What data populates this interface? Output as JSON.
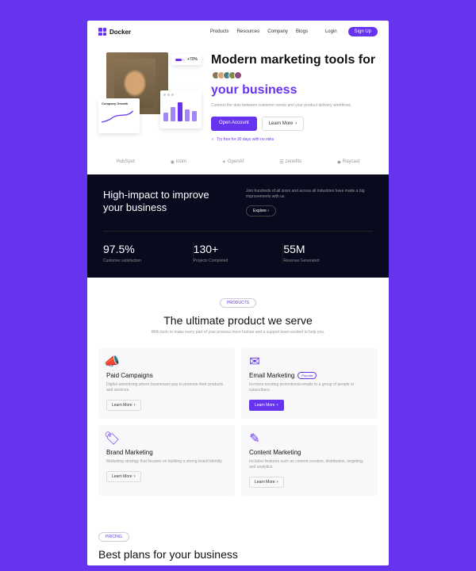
{
  "brand": "Docker",
  "nav": [
    "Products",
    "Resources",
    "Company",
    "Blogs"
  ],
  "auth": {
    "login": "Login",
    "signup": "Sign Up"
  },
  "hero": {
    "title_1": "Modern marketing tools for",
    "title_accent": "your business",
    "float_pct": "+70%",
    "float2_title": "Company Growth",
    "desc": "Connect the dots between customer needs and your product delivery workflows.",
    "cta_primary": "Open Account",
    "cta_secondary": "Learn More",
    "trial": "Try free for 30 days with no risks"
  },
  "logos": [
    "HubSpot",
    "loom",
    "OpenAI",
    "zenefits",
    "Raycast"
  ],
  "impact": {
    "title": "High-impact to improve your business",
    "desc": "Join hundreds of all sizes and across all industries have made a big improvements with us.",
    "explore": "Explore",
    "stats": [
      {
        "val": "97.5%",
        "label": "Customer satisfaction"
      },
      {
        "val": "130+",
        "label": "Projects Completed"
      },
      {
        "val": "55M",
        "label": "Revenue Generated"
      }
    ]
  },
  "products": {
    "badge": "Products",
    "title": "The ultimate product we serve",
    "desc": "With tools to make every part of your process more human and a support team excited to help you.",
    "cards": [
      {
        "title": "Paid Campaigns",
        "desc": "Digital advertising where businesses pay to promote their products and services.",
        "cta": "Learn More",
        "badge": ""
      },
      {
        "title": "Email Marketing",
        "desc": "Involves sending promotional emails to a group of people or subscribers.",
        "cta": "Learn More",
        "badge": "Popular",
        "ctaPrimary": true
      },
      {
        "title": "Brand Marketing",
        "desc": "Marketing strategy that focuses on building a strong brand identity.",
        "cta": "Learn More",
        "badge": ""
      },
      {
        "title": "Content Marketing",
        "desc": "Includes features such as content creation, distribution, targeting, and analytics.",
        "cta": "Learn More",
        "badge": ""
      }
    ]
  },
  "plans": {
    "badge": "Pricing",
    "title": "Best plans for your business"
  }
}
